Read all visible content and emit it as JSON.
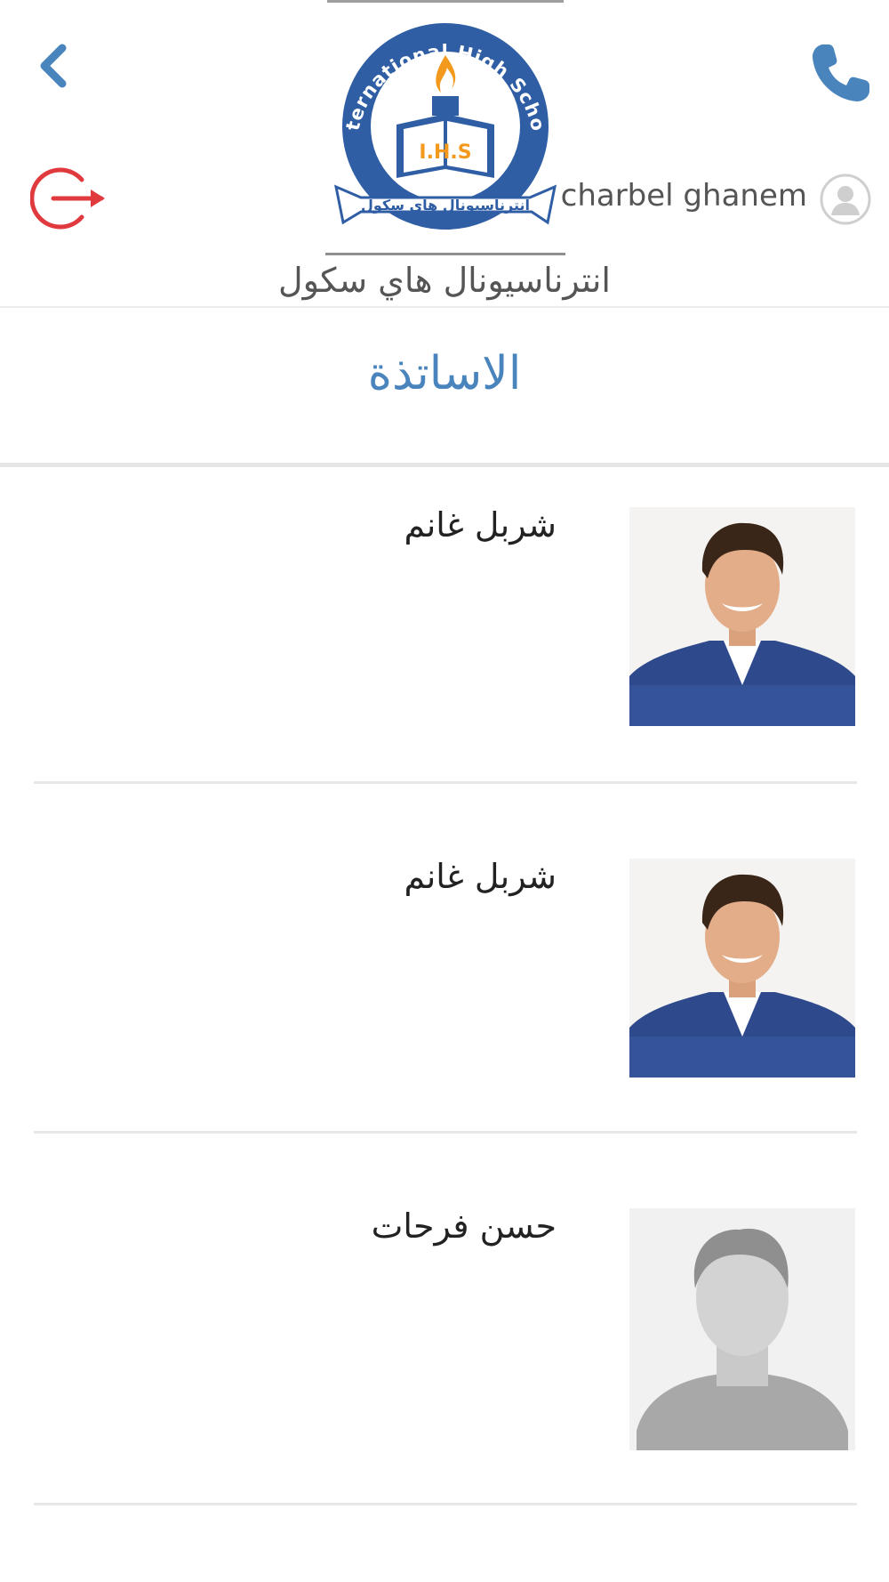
{
  "header": {
    "school_name": "انترناسيونال هاي سكول",
    "logo": {
      "ring_text": "International High School",
      "initials": "I.H.S",
      "banner_text": "انترناسيونال هاي سكول"
    },
    "user_name": "charbel ghanem",
    "icons": {
      "back": "chevron-left-icon",
      "phone": "phone-icon",
      "logout": "logout-icon",
      "avatar": "user-avatar-icon"
    },
    "colors": {
      "accent": "#4a84bd",
      "logout": "#e03a3e"
    }
  },
  "page_title": "الاساتذة",
  "teachers": [
    {
      "name": "شربل غانم",
      "photo": "person-photo"
    },
    {
      "name": "شربل غانم",
      "photo": "person-photo"
    },
    {
      "name": "حسن فرحات",
      "photo": "default-avatar"
    }
  ]
}
